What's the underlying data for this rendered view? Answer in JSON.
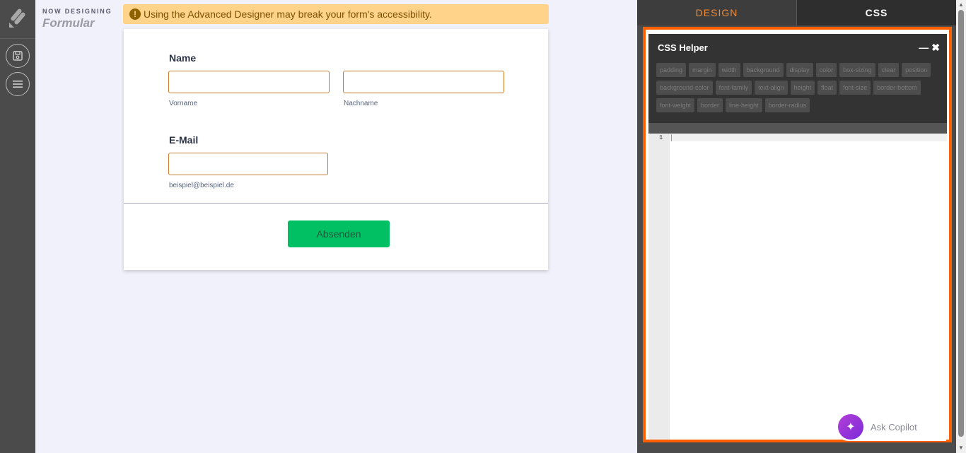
{
  "sidebar": {
    "logo_icon": "jotform-logo-icon",
    "buttons": [
      {
        "icon": "save-icon"
      },
      {
        "icon": "menu-icon"
      }
    ]
  },
  "header": {
    "now_designing_label": "NOW DESIGNING",
    "form_name": "Formular"
  },
  "warning": {
    "icon": "exclamation-icon",
    "icon_glyph": "!",
    "text": "Using the Advanced Designer may break your form's accessibility."
  },
  "form": {
    "name_label": "Name",
    "first_name_sublabel": "Vorname",
    "last_name_sublabel": "Nachname",
    "email_label": "E-Mail",
    "email_sublabel": "beispiel@beispiel.de",
    "submit_label": "Absenden",
    "submit_color": "#00c063",
    "input_border_color": "#c77a2a"
  },
  "panel": {
    "tabs": [
      {
        "label": "DESIGN",
        "active": false
      },
      {
        "label": "CSS",
        "active": true
      }
    ],
    "accent_color": "#ff6100",
    "css_helper": {
      "title": "CSS Helper",
      "minimize_glyph": "—",
      "close_glyph": "✖",
      "chips": [
        "padding",
        "margin",
        "width",
        "background",
        "display",
        "color",
        "box-sizing",
        "clear",
        "position",
        "background-color",
        "font-family",
        "text-align",
        "height",
        "float",
        "font-size",
        "border-bottom",
        "font-weight",
        "border",
        "line-height",
        "border-radius"
      ]
    },
    "editor": {
      "line_number": "1",
      "content": ""
    }
  },
  "copilot": {
    "icon": "sparkle-icon",
    "icon_glyph": "✦",
    "label": "Ask Copilot"
  }
}
